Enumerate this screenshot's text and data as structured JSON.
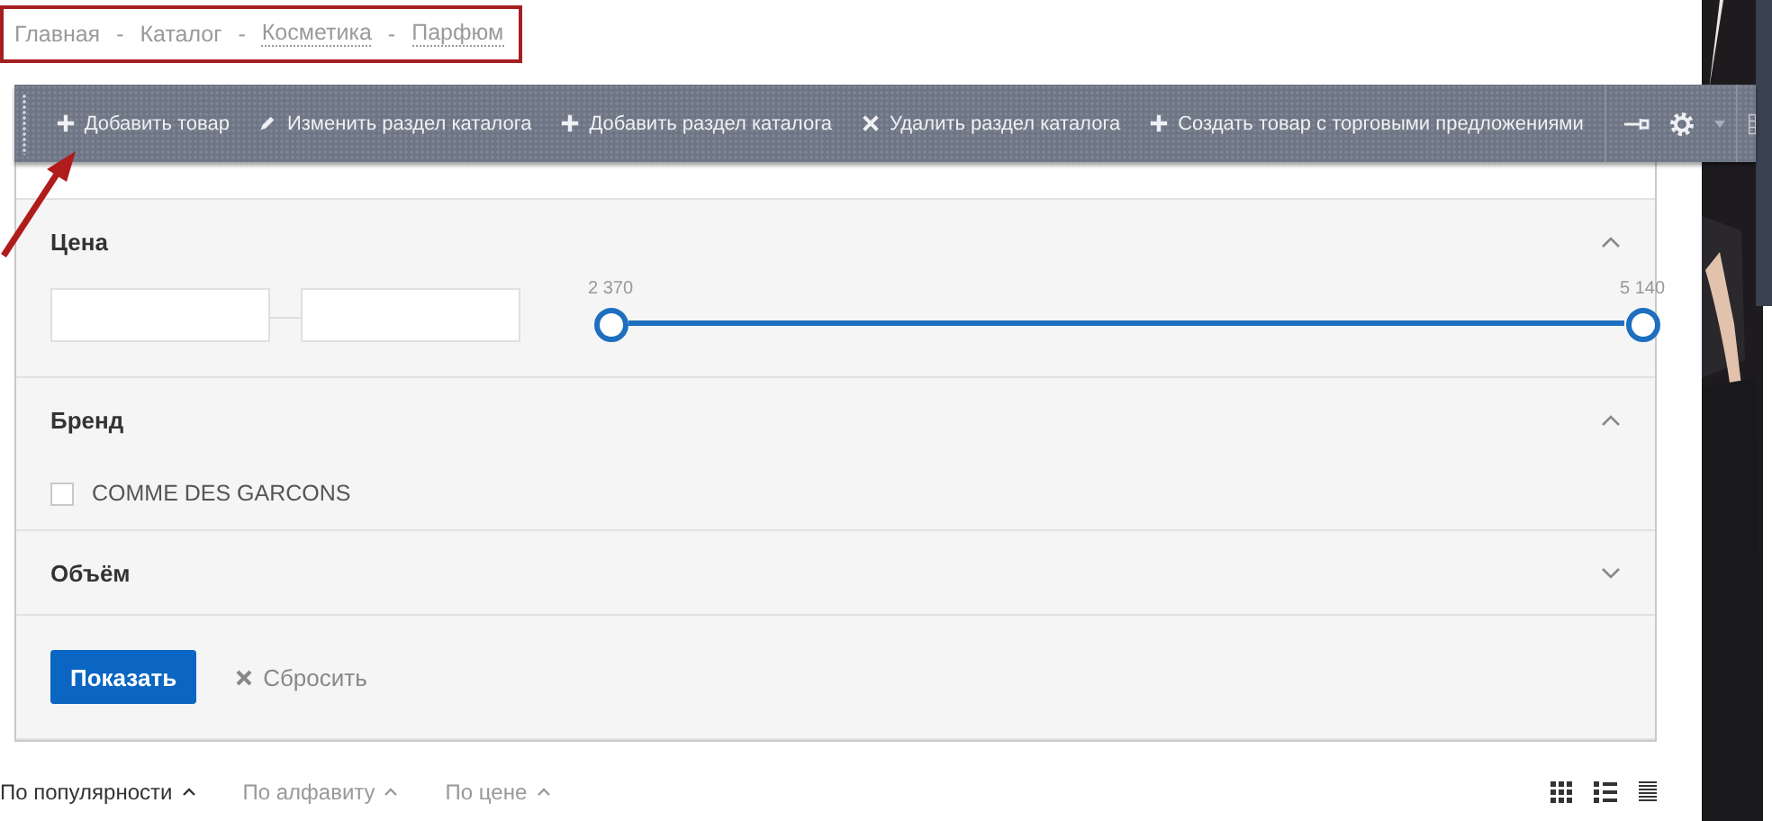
{
  "breadcrumbs": [
    {
      "label": "Главная",
      "kind": "plain"
    },
    {
      "label": "Каталог",
      "kind": "plain"
    },
    {
      "label": "Косметика",
      "kind": "link"
    },
    {
      "label": "Парфюм",
      "kind": "link"
    }
  ],
  "breadcrumb_separator": "-",
  "toolbar": {
    "items": [
      {
        "label": "Добавить товар",
        "kind": "add"
      },
      {
        "label": "Изменить раздел каталога",
        "kind": "edit"
      },
      {
        "label": "Добавить раздел каталога",
        "kind": "add"
      },
      {
        "label": "Удалить раздел каталога",
        "kind": "delete"
      },
      {
        "label": "Создать товар с торговыми предложениями",
        "kind": "add"
      }
    ]
  },
  "filter": {
    "sections": [
      {
        "kind": "range",
        "title": "Цена",
        "expanded": true,
        "handles": [
          {
            "label": "2 370",
            "level": 0
          },
          {
            "label": "5 140",
            "level": 1
          }
        ]
      },
      {
        "kind": "checklist",
        "title": "Бренд",
        "expanded": true,
        "options": [
          {
            "label": "COMME DES GARCONS",
            "checked": false
          }
        ]
      },
      {
        "title": "Объём",
        "expanded": false
      }
    ],
    "apply_button": "Показать",
    "reset_link": "Сбросить"
  },
  "sort": {
    "options": [
      {
        "label": "По популярности",
        "selected": true
      },
      {
        "label": "По алфавиту",
        "selected": false
      },
      {
        "label": "По цене",
        "selected": false
      }
    ],
    "views": [
      {
        "kind": "grid"
      },
      {
        "kind": "list"
      },
      {
        "kind": "table"
      }
    ]
  }
}
